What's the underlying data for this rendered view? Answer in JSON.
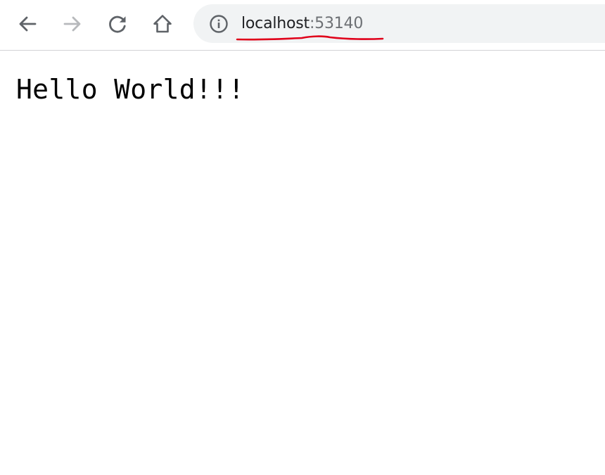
{
  "browser": {
    "address_bar": {
      "host": "localhost",
      "rest": ":53140"
    },
    "icons": {
      "back": "arrow-left-icon",
      "forward": "arrow-right-icon",
      "reload": "reload-icon",
      "home": "home-icon",
      "site_info": "info-circle-icon"
    },
    "colors": {
      "active_icon": "#5f6368",
      "disabled_icon": "#b7b9bc",
      "omnibox_bg": "#f1f3f4",
      "annotation": "#e0001a"
    }
  },
  "page": {
    "body_text": "Hello World!!!"
  }
}
